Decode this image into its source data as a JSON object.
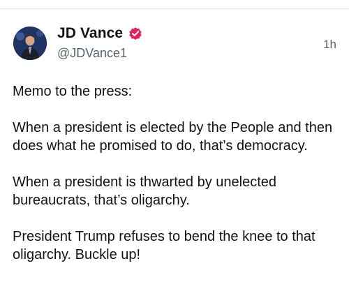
{
  "post": {
    "author": {
      "display_name": "JD Vance",
      "handle": "@JDVance1",
      "verified": true,
      "verified_badge_color": "#e0245e"
    },
    "timestamp": "1h",
    "paragraphs": [
      "Memo to the press:",
      "When a president is elected by the People and then does what he promised to do, that’s democracy.",
      "When a president is thwarted by unelected bureaucrats, that’s oligarchy.",
      "President Trump refuses to bend the knee to that oligarchy. Buckle up!"
    ]
  },
  "icons": {
    "verified": "verified-badge-icon"
  },
  "colors": {
    "text_primary": "#0f1419",
    "text_secondary": "#536471",
    "background": "#ffffff"
  }
}
